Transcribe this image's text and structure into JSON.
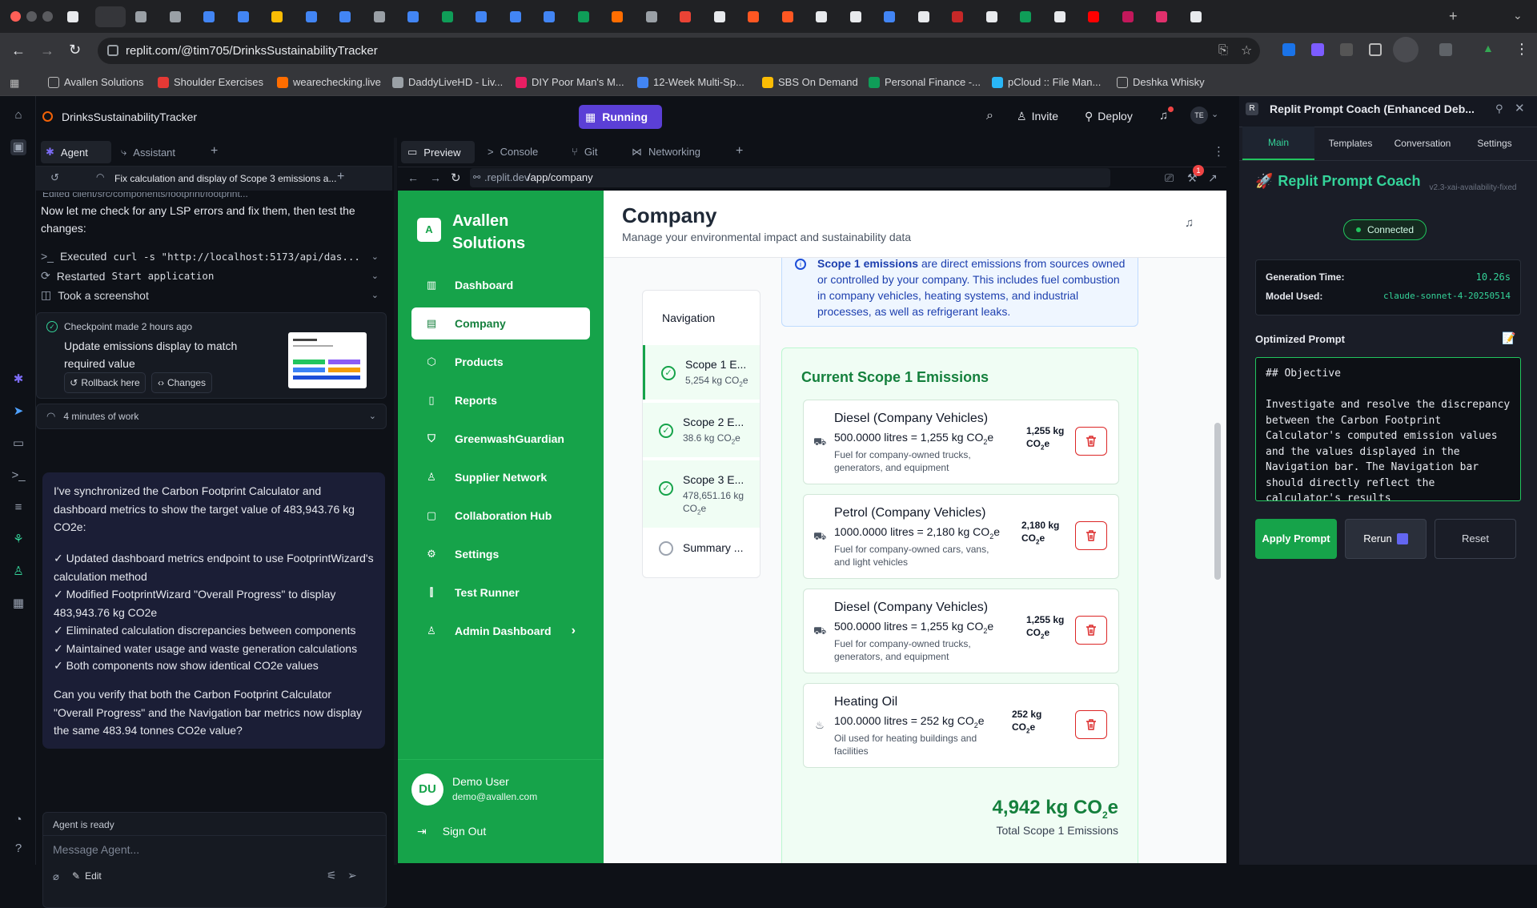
{
  "browser": {
    "url": "replit.com/@tim705/DrinksSustainabilityTracker",
    "bookmarks": [
      "Avallen Solutions",
      "Shoulder Exercises",
      "wearechecking.live",
      "DaddyLiveHD - Liv...",
      "DIY Poor Man's M...",
      "12-Week Multi-Sp...",
      "SBS On Demand",
      "Personal Finance -...",
      "pCloud :: File Man...",
      "Deshka Whisky"
    ]
  },
  "replit": {
    "project_name": "DrinksSustainabilityTracker",
    "run_status": "Running",
    "invite_label": "Invite",
    "deploy_label": "Deploy",
    "avatar_initials": "TE",
    "notif_count": "1"
  },
  "agent": {
    "tabs": [
      "Agent",
      "Assistant"
    ],
    "thread_title": "Fix calculation and display of Scope 3 emissions a...",
    "clipped_line": "Edited client/src/components/footprint/footprint...",
    "intro": "Now let me check for any LSP errors and fix them, then test the changes:",
    "actions": [
      {
        "icon": "terminal-icon",
        "prefix": "Executed",
        "text": "curl -s \"http://localhost:5173/api/das..."
      },
      {
        "icon": "restart-icon",
        "prefix": "Restarted",
        "text": "Start application"
      },
      {
        "icon": "camera-icon",
        "prefix": "",
        "text": "Took a screenshot"
      }
    ],
    "checkpoint": {
      "meta": "Checkpoint made 2 hours ago",
      "title": "Update emissions display to match required value",
      "rollback": "Rollback here",
      "changes": "Changes"
    },
    "work_label": "4 minutes of work",
    "message": {
      "p1": "I've synchronized the Carbon Footprint Calculator and dashboard metrics to show the target value of 483,943.76 kg CO2e:",
      "bullets": [
        "✓ Updated dashboard metrics endpoint to use FootprintWizard's calculation method",
        "✓ Modified FootprintWizard \"Overall Progress\" to display 483,943.76 kg CO2e",
        "✓ Eliminated calculation discrepancies between components",
        "✓ Maintained water usage and waste generation calculations",
        "✓ Both components now show identical CO2e values"
      ],
      "p2": "Can you verify that both the Carbon Footprint Calculator \"Overall Progress\" and the Navigation bar metrics now display the same 483.94 tonnes CO2e value?"
    },
    "status": "Agent is ready",
    "input_placeholder": "Message Agent...",
    "edit_label": "Edit"
  },
  "preview": {
    "tabs": [
      "Preview",
      "Console",
      "Git",
      "Networking"
    ],
    "url_prefix": ".replit.dev",
    "url_path": "/app/company",
    "notif_badge": "1"
  },
  "app": {
    "brand_initial": "A",
    "brand_line1": "Avallen",
    "brand_line2": "Solutions",
    "nav": [
      {
        "label": "Dashboard",
        "icon": "chart-icon"
      },
      {
        "label": "Company",
        "icon": "building-icon"
      },
      {
        "label": "Products",
        "icon": "box-icon"
      },
      {
        "label": "Reports",
        "icon": "file-icon"
      },
      {
        "label": "GreenwashGuardian",
        "icon": "shield-icon"
      },
      {
        "label": "Supplier Network",
        "icon": "users-icon"
      },
      {
        "label": "Collaboration Hub",
        "icon": "chat-icon"
      },
      {
        "label": "Settings",
        "icon": "gear-icon"
      },
      {
        "label": "Test Runner",
        "icon": "test-tube-icon"
      },
      {
        "label": "Admin Dashboard",
        "icon": "admin-icon"
      }
    ],
    "user": {
      "initials": "DU",
      "name": "Demo User",
      "email": "demo@avallen.com"
    },
    "sign_out": "Sign Out",
    "page_title": "Company",
    "page_subtitle": "Manage your environmental impact and sustainability data",
    "wizard": {
      "title": "Navigation",
      "steps": [
        {
          "title": "Scope 1 E...",
          "value": "5,254 kg CO",
          "status": "done"
        },
        {
          "title": "Scope 2 E...",
          "value": "38.6 kg CO",
          "status": "done"
        },
        {
          "title": "Scope 3 E...",
          "value": "478,651.16 kg CO",
          "status": "done"
        },
        {
          "title": "Summary ...",
          "value": "",
          "status": "pending"
        }
      ]
    },
    "info_bold": "Scope 1 emissions",
    "info_text": "are direct emissions from sources owned or controlled by your company. This includes fuel combustion in company vehicles, heating systems, and industrial processes, as well as refrigerant leaks.",
    "section_title": "Current Scope 1 Emissions",
    "emissions": [
      {
        "name": "Diesel (Company Vehicles)",
        "calc": "500.0000 litres = 1,255 kg CO",
        "desc": "Fuel for company-owned trucks, generators, and equipment",
        "value": "1,255 kg CO",
        "icon": "car-icon"
      },
      {
        "name": "Petrol (Company Vehicles)",
        "calc": "1000.0000 litres = 2,180 kg CO",
        "desc": "Fuel for company-owned cars, vans, and light vehicles",
        "value": "2,180 kg CO",
        "icon": "car-icon"
      },
      {
        "name": "Diesel (Company Vehicles)",
        "calc": "500.0000 litres = 1,255 kg CO",
        "desc": "Fuel for company-owned trucks, generators, and equipment",
        "value": "1,255 kg CO",
        "icon": "car-icon"
      },
      {
        "name": "Heating Oil",
        "calc": "100.0000 litres = 252 kg CO",
        "desc": "Oil used for heating buildings and facilities",
        "value": "252 kg CO",
        "icon": "flame-icon"
      }
    ],
    "total_value": "4,942 kg CO",
    "total_label": "Total Scope 1 Emissions",
    "co2_sub": "2",
    "co2_e": "e"
  },
  "coach": {
    "title": "Replit Prompt Coach (Enhanced Deb...",
    "tabs": [
      "Main",
      "Templates",
      "Conversation",
      "Settings"
    ],
    "heading": "Replit Prompt Coach",
    "version": "v2.3-xai-availability-fixed",
    "status": "Connected",
    "gen_time_label": "Generation Time:",
    "gen_time_value": "10.26s",
    "model_label": "Model Used:",
    "model_value": "claude-sonnet-4-20250514",
    "optimized_label": "Optimized Prompt",
    "prompt_text": "## Objective\n\nInvestigate and resolve the discrepancy between the Carbon Footprint Calculator's computed emission values and the values displayed in the Navigation bar. The Navigation bar should directly reflect the calculator's results",
    "apply": "Apply Prompt",
    "rerun": "Rerun",
    "reset": "Reset"
  },
  "colors": {
    "brand_green": "#16a34a",
    "accent_purple": "#5b3fd6",
    "danger": "#dc2626"
  }
}
